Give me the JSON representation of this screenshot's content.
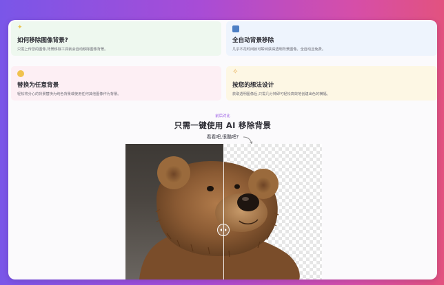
{
  "features": [
    {
      "icon": "sparkle-icon",
      "title": "如何移除图像背景?",
      "description": "只需上传您的图像,背景移除工具就会自动移除图像背景。",
      "background": "#eef8ef"
    },
    {
      "icon": "picture-frame-icon",
      "title": "全自动背景移除",
      "description": "几乎不花时间就可瞬间获得透明背景图像。全自动且免费。",
      "background": "#eef4fd"
    },
    {
      "icon": "smiley-face-icon",
      "title": "替换为任意背景",
      "description": "轻松将分心的背景替换为纯色背景或使用任何其他图像作为背景。",
      "background": "#fdeff4"
    },
    {
      "icon": "confetti-icon",
      "title": "按您的想法设计",
      "description": "获取透明图像后,只需几分钟即可轻松高效地创建出色的横幅。",
      "background": "#fdf7e4"
    }
  ],
  "showcase": {
    "badge": "前后对比",
    "heading": "只需一键使用 AI 移除背景",
    "subheading": "看看吧,很酷吧?"
  },
  "compare": {
    "handle_icon": "compare-slider-handle-icon",
    "slider_position_percent": 50
  },
  "colors": {
    "accent": "#9b5de5",
    "gradient_start": "#7a56e8",
    "gradient_end": "#e2527f",
    "panel": "#fbfafc"
  }
}
